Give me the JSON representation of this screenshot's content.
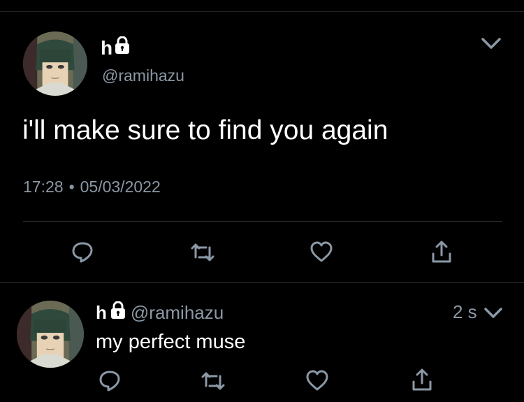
{
  "main_tweet": {
    "author_name": "h",
    "author_handle": "@ramihazu",
    "text": "i'll make sure to find you again",
    "time": "17:28",
    "separator": "•",
    "date": "05/03/2022",
    "icons": {
      "avatar": "avatar-icon",
      "lock": "lock-icon",
      "caret": "chevron-down-icon",
      "reply": "reply-icon",
      "retweet": "retweet-icon",
      "like": "heart-icon",
      "share": "share-icon"
    }
  },
  "reply_tweet": {
    "author_name": "h",
    "author_handle": "@ramihazu",
    "timestamp": "2 s",
    "text": "my perfect muse"
  },
  "colors": {
    "background": "#000000",
    "text_primary": "#ffffff",
    "text_secondary": "#8b98a5",
    "divider": "#2f3336"
  }
}
